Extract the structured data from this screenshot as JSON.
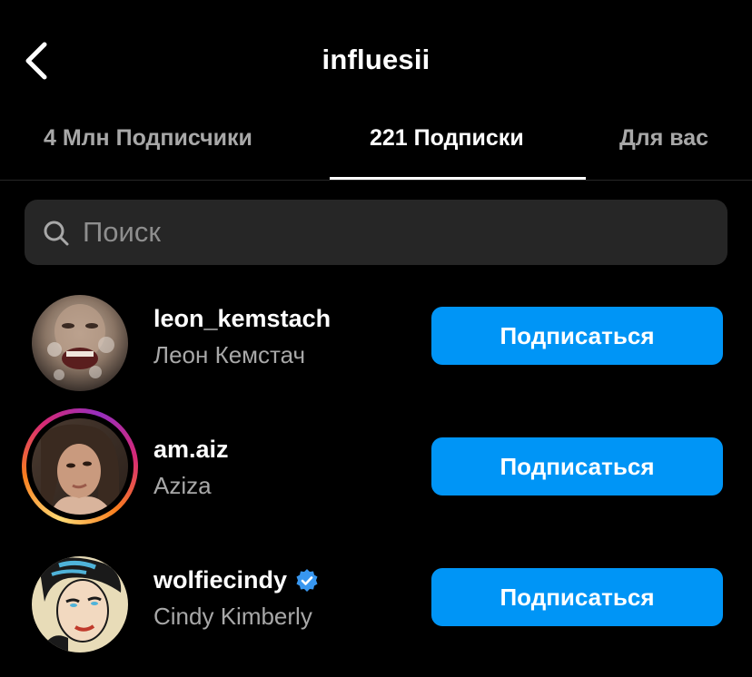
{
  "header": {
    "title": "influesii"
  },
  "tabs": [
    {
      "label": "4 Млн Подписчики",
      "active": false
    },
    {
      "label": "221 Подписки",
      "active": true
    },
    {
      "label": "Для вас",
      "active": false
    }
  ],
  "search": {
    "placeholder": "Поиск",
    "value": ""
  },
  "users": [
    {
      "username": "leon_kemstach",
      "full_name": "Леон Кемстач",
      "verified": false,
      "has_story": false,
      "follow_label": "Подписаться"
    },
    {
      "username": "am.aiz",
      "full_name": "Aziza",
      "verified": false,
      "has_story": true,
      "follow_label": "Подписаться"
    },
    {
      "username": "wolfiecindy",
      "full_name": "Cindy Kimberly",
      "verified": true,
      "has_story": false,
      "follow_label": "Подписаться"
    }
  ],
  "colors": {
    "background": "#000000",
    "accent": "#0095f6",
    "secondary_text": "#a8a8a8",
    "search_bg": "#262626",
    "verified": "#3897f0"
  },
  "icons": {
    "back": "chevron-left-icon",
    "search": "search-icon",
    "verified": "verified-badge-icon"
  }
}
